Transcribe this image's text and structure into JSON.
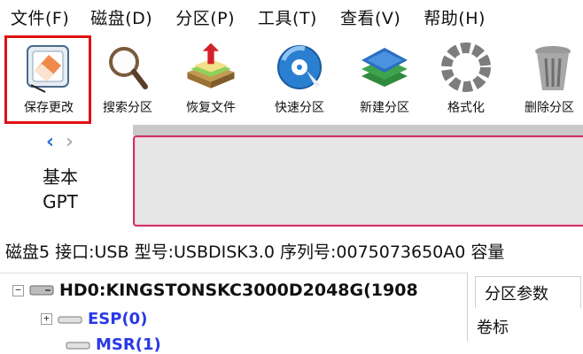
{
  "menu": [
    "文件(F)",
    "磁盘(D)",
    "分区(P)",
    "工具(T)",
    "查看(V)",
    "帮助(H)"
  ],
  "toolbar": {
    "items": [
      {
        "label": "保存更改",
        "icon": "eraser-save-icon"
      },
      {
        "label": "搜索分区",
        "icon": "magnifier-icon"
      },
      {
        "label": "恢复文件",
        "icon": "recover-files-icon"
      },
      {
        "label": "快速分区",
        "icon": "quick-partition-disc-icon"
      },
      {
        "label": "新建分区",
        "icon": "new-partition-layers-icon"
      },
      {
        "label": "格式化",
        "icon": "format-gear-icon"
      },
      {
        "label": "删除分区",
        "icon": "trash-bin-icon"
      }
    ]
  },
  "disk_panel": {
    "nav_left": "‹",
    "nav_right": "›",
    "type_line1": "基本",
    "type_line2": "GPT"
  },
  "disk_info": "磁盘5 接口:USB  型号:USBDISK3.0  序列号:0075073650A0  容量",
  "tree": {
    "disk": "HD0:KINGSTONSKC3000D2048G(1908",
    "partitions": [
      "ESP(0)",
      "MSR(1)"
    ]
  },
  "right_panel": {
    "tab": "分区参数",
    "field": "卷标"
  },
  "colors": {
    "highlight": "#e01010",
    "partition_text": "#2a39e6",
    "disk_bar_border": "#d0306a"
  }
}
